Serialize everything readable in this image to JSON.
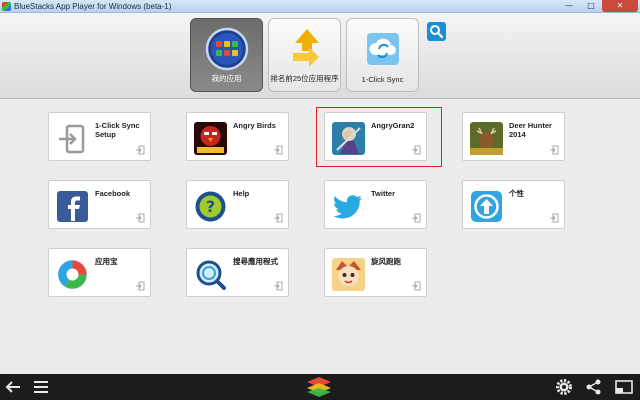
{
  "window": {
    "title": "BlueStacks App Player for Windows (beta-1)",
    "minimize": "—",
    "maximize": "□",
    "close": "✕"
  },
  "nav": {
    "tabs": [
      {
        "label": "我的应用",
        "icon": "my-apps-grid-icon",
        "active": true
      },
      {
        "label": "排名前25位应用程序",
        "icon": "top-25-arrow-icon",
        "active": false
      },
      {
        "label": "1-Click Sync",
        "icon": "cloud-sync-icon",
        "active": false
      }
    ],
    "search_icon": "search-icon"
  },
  "apps": [
    {
      "name": "1-Click Sync Setup",
      "icon": "sync-setup-icon"
    },
    {
      "name": "Angry Birds",
      "icon": "angry-birds-star-wars-icon"
    },
    {
      "name": "AngryGran2",
      "icon": "angry-gran-icon",
      "highlighted": true
    },
    {
      "name": "Deer Hunter 2014",
      "icon": "deer-hunter-icon"
    },
    {
      "name": "Facebook",
      "icon": "facebook-icon"
    },
    {
      "name": "Help",
      "icon": "help-icon"
    },
    {
      "name": "Twitter",
      "icon": "twitter-icon"
    },
    {
      "name": "个性",
      "icon": "personalize-icon"
    },
    {
      "name": "应用宝",
      "icon": "app-store-icon"
    },
    {
      "name": "搜尋應用程式",
      "icon": "search-apps-icon"
    },
    {
      "name": "旋风跑跑",
      "icon": "game-character-icon"
    }
  ],
  "bottom": {
    "back_icon": "back-arrow-icon",
    "menu_icon": "menu-icon",
    "logo_icon": "bluestacks-logo-icon",
    "settings_icon": "gear-icon",
    "share_icon": "share-icon",
    "screen_icon": "fullscreen-icon"
  },
  "colors": {
    "accent": "#1a8fd6",
    "highlight": "#e02020"
  }
}
